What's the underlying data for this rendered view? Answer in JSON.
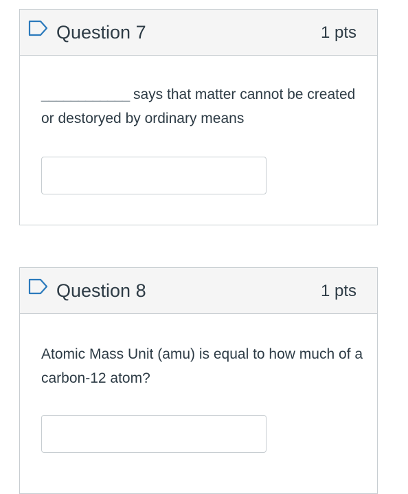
{
  "questions": [
    {
      "title": "Question 7",
      "points": "1 pts",
      "text_blank": "____________",
      "text": "says that matter cannot be created or destoryed by ordinary means",
      "answer_value": ""
    },
    {
      "title": "Question 8",
      "points": "1 pts",
      "text": "Atomic Mass Unit (amu) is equal to how much of a carbon-12 atom?",
      "answer_value": ""
    }
  ],
  "colors": {
    "header_bg": "#f5f5f5",
    "border": "#c7cdd1",
    "text": "#2d3b45",
    "flag": "#2b7abc"
  }
}
